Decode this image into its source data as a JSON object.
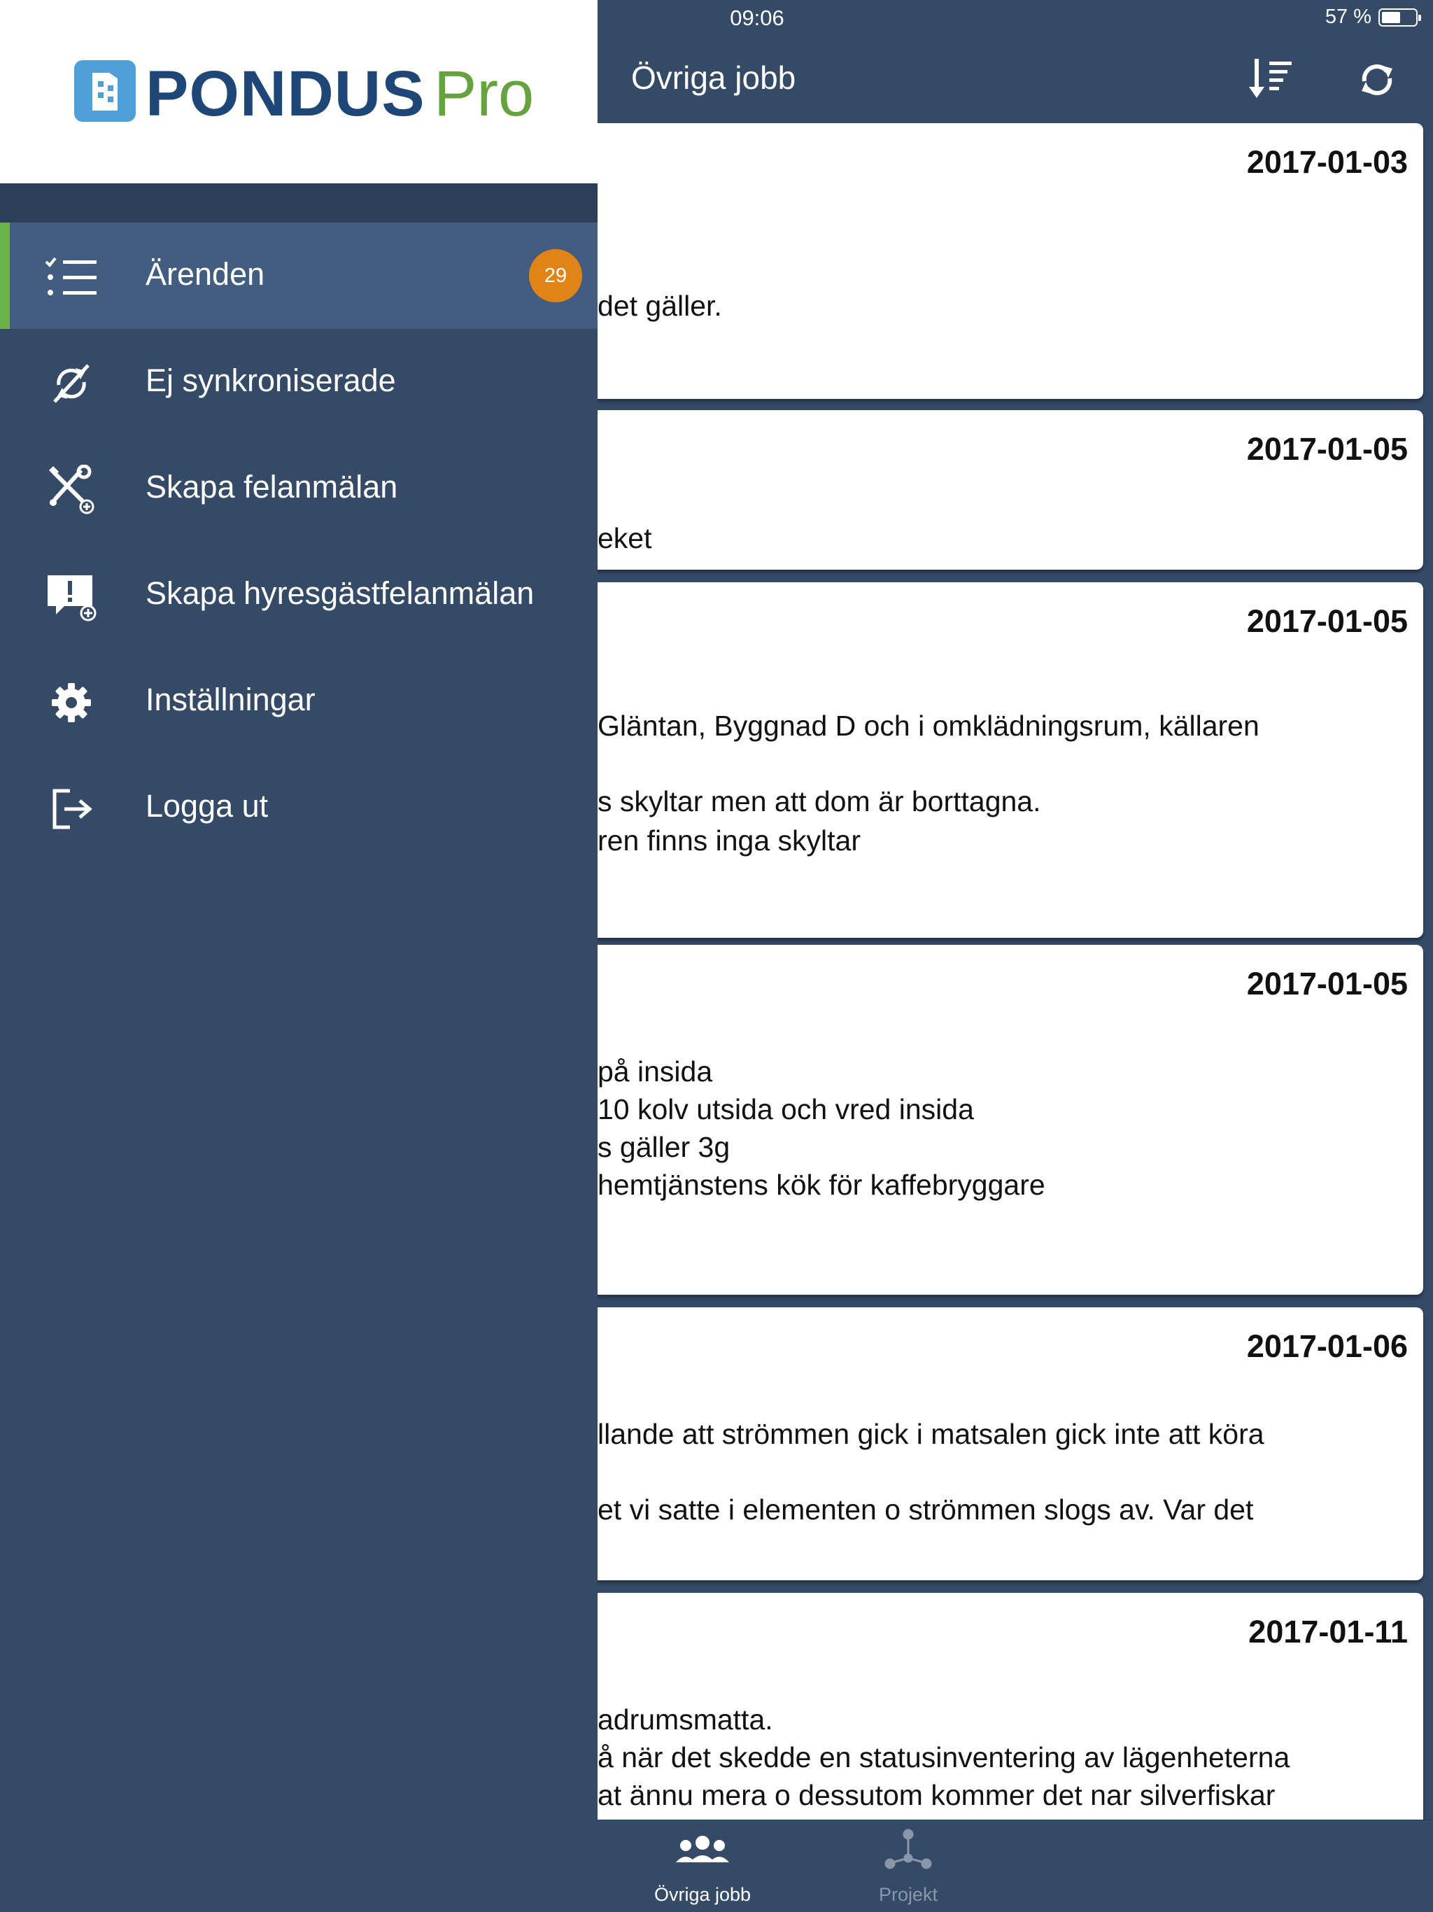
{
  "status": {
    "time": "09:06",
    "battery": "57 %",
    "battery_level": 0.57
  },
  "nav": {
    "title": "Övriga jobb",
    "sort_icon": "sort-descending-icon",
    "sync_icon": "refresh-icon"
  },
  "cards": [
    {
      "date": "2017-01-03",
      "lines": [
        "det gäller."
      ]
    },
    {
      "date": "2017-01-05",
      "lines": [
        "eket"
      ]
    },
    {
      "date": "2017-01-05",
      "lines": [
        "Gläntan, Byggnad D och i omklädningsrum, källaren",
        "s skyltar men att dom är borttagna.",
        "ren finns inga skyltar"
      ]
    },
    {
      "date": "2017-01-05",
      "lines": [
        "på insida",
        "10 kolv utsida och vred insida",
        "s gäller 3g",
        "hemtjänstens kök för kaffebryggare"
      ]
    },
    {
      "date": "2017-01-06",
      "lines": [
        "llande att strömmen gick i matsalen gick inte att köra",
        "et vi satte i elementen o strömmen slogs av. Var det"
      ]
    },
    {
      "date": "2017-01-11",
      "lines": [
        "adrumsmatta.",
        "å när det skedde en statusinventering av lägenheterna",
        "at ännu mera o dessutom kommer det nar silverfiskar"
      ]
    }
  ],
  "tabs": [
    {
      "label": "Övriga jobb",
      "icon": "people-group-icon",
      "active": true
    },
    {
      "label": "Projekt",
      "icon": "project-network-icon",
      "active": false
    }
  ],
  "drawer": {
    "logo": {
      "brand": "PONDUS",
      "suffix": "Pro"
    },
    "items": [
      {
        "label": "Ärenden",
        "icon": "checklist-icon",
        "badge": "29",
        "active": true
      },
      {
        "label": "Ej synkroniserade",
        "icon": "sync-off-icon"
      },
      {
        "label": "Skapa felanmälan",
        "icon": "tools-add-icon"
      },
      {
        "label": "Skapa hyresgästfelanmälan",
        "icon": "alert-message-add-icon"
      },
      {
        "label": "Inställningar",
        "icon": "gear-icon"
      },
      {
        "label": "Logga ut",
        "icon": "logout-icon"
      }
    ]
  },
  "colors": {
    "header": "#354a66",
    "active_item": "#425d80",
    "accent_green": "#6ab04c",
    "badge": "#e08417",
    "logo_blue": "#1e4777"
  }
}
